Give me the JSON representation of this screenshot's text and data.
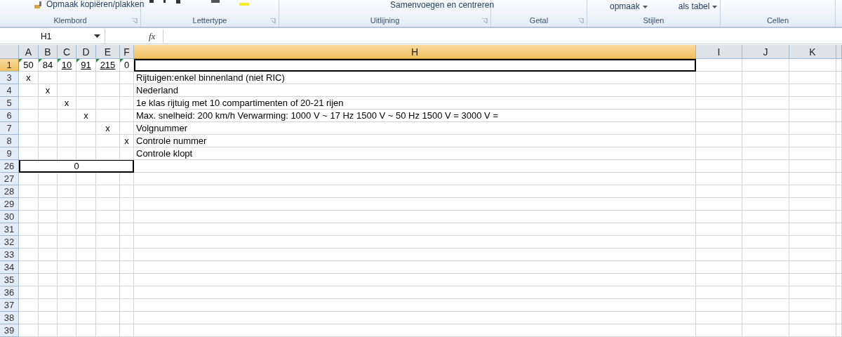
{
  "ribbon": {
    "groups": [
      {
        "label": "Klembord",
        "items": [
          "Opmaak kopiëren/plakken"
        ]
      },
      {
        "label": "Lettertype"
      },
      {
        "label": "Uitlijning",
        "items": [
          "Samenvoegen en centreren"
        ]
      },
      {
        "label": "Getal"
      },
      {
        "label": "Stijlen",
        "items": [
          "opmaak",
          "als tabel"
        ]
      },
      {
        "label": "Cellen"
      }
    ]
  },
  "formula_bar": {
    "name_box": "H1",
    "function_symbol": "fx"
  },
  "columns": [
    {
      "label": "A",
      "selected": false
    },
    {
      "label": "B",
      "selected": false
    },
    {
      "label": "C",
      "selected": false
    },
    {
      "label": "D",
      "selected": false
    },
    {
      "label": "E",
      "selected": false
    },
    {
      "label": "F",
      "selected": false
    },
    {
      "label": "H",
      "selected": true
    },
    {
      "label": "I",
      "selected": false
    },
    {
      "label": "J",
      "selected": false
    },
    {
      "label": "K",
      "selected": false
    }
  ],
  "rows": [
    {
      "header": "1",
      "selected": true,
      "a": {
        "text": "50",
        "underlined": false,
        "flagged": true
      },
      "b": {
        "text": "84",
        "underlined": false,
        "flagged": true
      },
      "c": {
        "text": "10",
        "underlined": true,
        "flagged": true
      },
      "d": {
        "text": "91",
        "underlined": true,
        "flagged": true
      },
      "e": {
        "text": "215",
        "underlined": true,
        "flagged": true
      },
      "f": {
        "text": "0",
        "underlined": false,
        "flagged": true
      },
      "h": {
        "active": true
      }
    },
    {
      "header": "3",
      "selected": false,
      "a": "x",
      "h": "Rijtuigen:enkel binnenland (niet RIC)"
    },
    {
      "header": "4",
      "selected": false,
      "b": "x",
      "h": "Nederland"
    },
    {
      "header": "5",
      "selected": false,
      "c": "x",
      "h": "1e klas rijtuig met 10 compartimenten of 20-21 rijen"
    },
    {
      "header": "6",
      "selected": false,
      "d": "x",
      "h": "Max. snelheid: 200 km/h Verwarming: 1000 V ~ 17 Hz 1500 V ~ 50 Hz 1500 V = 3000 V ="
    },
    {
      "header": "7",
      "selected": false,
      "e": "x",
      "h": "Volgnummer"
    },
    {
      "header": "8",
      "selected": false,
      "f": "x",
      "h": "Controle nummer"
    },
    {
      "header": "9",
      "selected": false,
      "h": "Controle klopt"
    },
    {
      "header": "26",
      "selected": false,
      "merged_a_to_f": "0"
    },
    {
      "header": "27",
      "selected": false
    },
    {
      "header": "28",
      "selected": false
    },
    {
      "header": "29",
      "selected": false
    },
    {
      "header": "30",
      "selected": false
    },
    {
      "header": "31",
      "selected": false
    },
    {
      "header": "32",
      "selected": false
    },
    {
      "header": "33",
      "selected": false
    },
    {
      "header": "34",
      "selected": false
    },
    {
      "header": "35",
      "selected": false
    },
    {
      "header": "36",
      "selected": false
    },
    {
      "header": "37",
      "selected": false
    },
    {
      "header": "38",
      "selected": false
    },
    {
      "header": "39",
      "selected": false
    }
  ]
}
